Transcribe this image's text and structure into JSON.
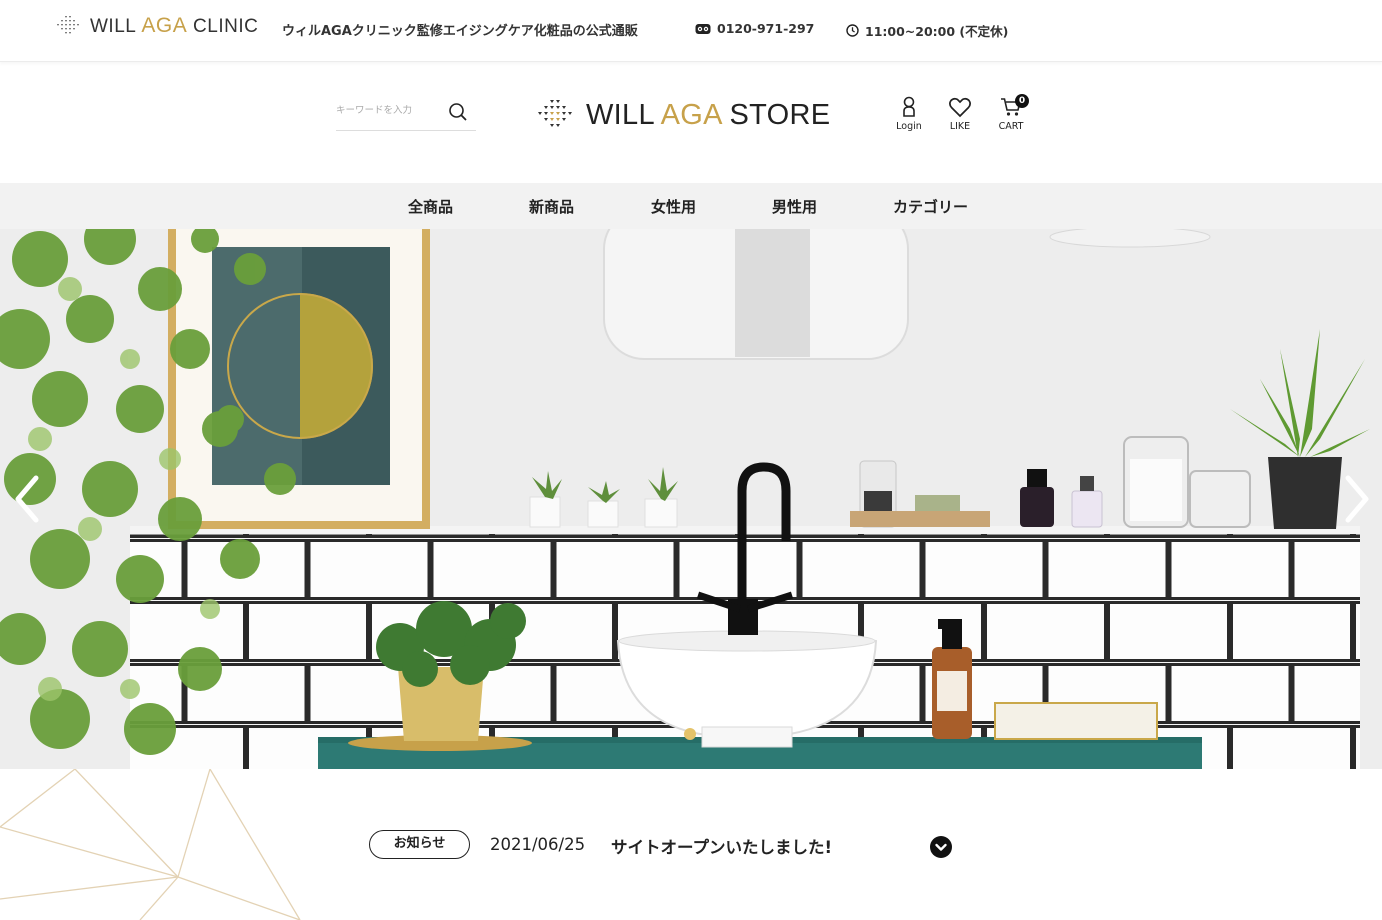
{
  "topbar": {
    "clinic_prefix": "WILL ",
    "clinic_aga": "AGA",
    "clinic_suffix": " CLINIC",
    "tagline": "ウィルAGAクリニック監修エイジングケア化粧品の公式通販",
    "phone": "0120-971-297",
    "hours": "11:00~20:00 (不定休)"
  },
  "header": {
    "search_placeholder": "キーワードを入力",
    "store_prefix": "WILL ",
    "store_aga": "AGA",
    "store_suffix": " STORE",
    "login_label": "Login",
    "like_label": "LIKE",
    "cart_label": "CART",
    "cart_count": "0"
  },
  "nav": {
    "items": [
      "全商品",
      "新商品",
      "女性用",
      "男性用",
      "カテゴリー"
    ]
  },
  "news": {
    "badge": "お知らせ",
    "date": "2021/06/25",
    "text": "サイトオープンいたしました!"
  },
  "colors": {
    "accent_gold": "#c7a14a",
    "nav_bg": "#f2f2f2",
    "text": "#222222"
  },
  "icons": {
    "search": "search-icon",
    "login": "user-icon",
    "like": "heart-icon",
    "cart": "cart-icon",
    "phone": "free-dial-icon",
    "hours": "clock-icon",
    "prev": "chevron-left-icon",
    "next": "chevron-right-icon",
    "toggle": "chevron-down-icon"
  }
}
